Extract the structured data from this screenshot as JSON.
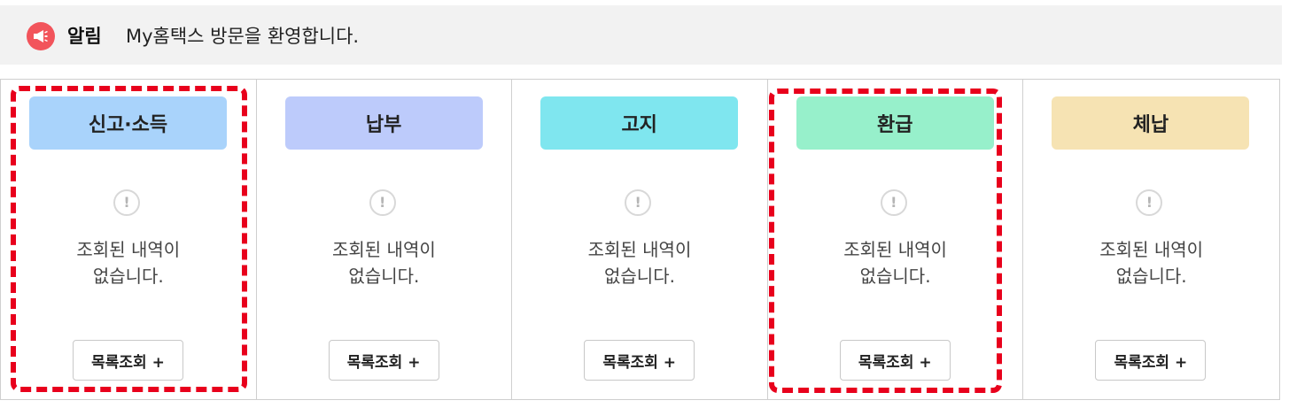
{
  "notice": {
    "label": "알림",
    "message": "My홈택스 방문을 환영합니다.",
    "icon": "megaphone-icon",
    "icon_color": "#f2545b"
  },
  "panels": [
    {
      "title": "신고·소득",
      "header_color": "#a9d3fb",
      "empty_message_line1": "조회된 내역이",
      "empty_message_line2": "없습니다.",
      "button_label": "목록조회 +",
      "highlighted": true
    },
    {
      "title": "납부",
      "header_color": "#bdcbfb",
      "empty_message_line1": "조회된 내역이",
      "empty_message_line2": "없습니다.",
      "button_label": "목록조회 +",
      "highlighted": false
    },
    {
      "title": "고지",
      "header_color": "#7fe6ef",
      "empty_message_line1": "조회된 내역이",
      "empty_message_line2": "없습니다.",
      "button_label": "목록조회 +",
      "highlighted": false
    },
    {
      "title": "환급",
      "header_color": "#97f0cb",
      "empty_message_line1": "조회된 내역이",
      "empty_message_line2": "없습니다.",
      "button_label": "목록조회 +",
      "highlighted": true
    },
    {
      "title": "체납",
      "header_color": "#f6e3b3",
      "empty_message_line1": "조회된 내역이",
      "empty_message_line2": "없습니다.",
      "button_label": "목록조회 +",
      "highlighted": false
    }
  ],
  "colors": {
    "highlight": "#e8001c",
    "notice_background": "#f2f2f2"
  }
}
